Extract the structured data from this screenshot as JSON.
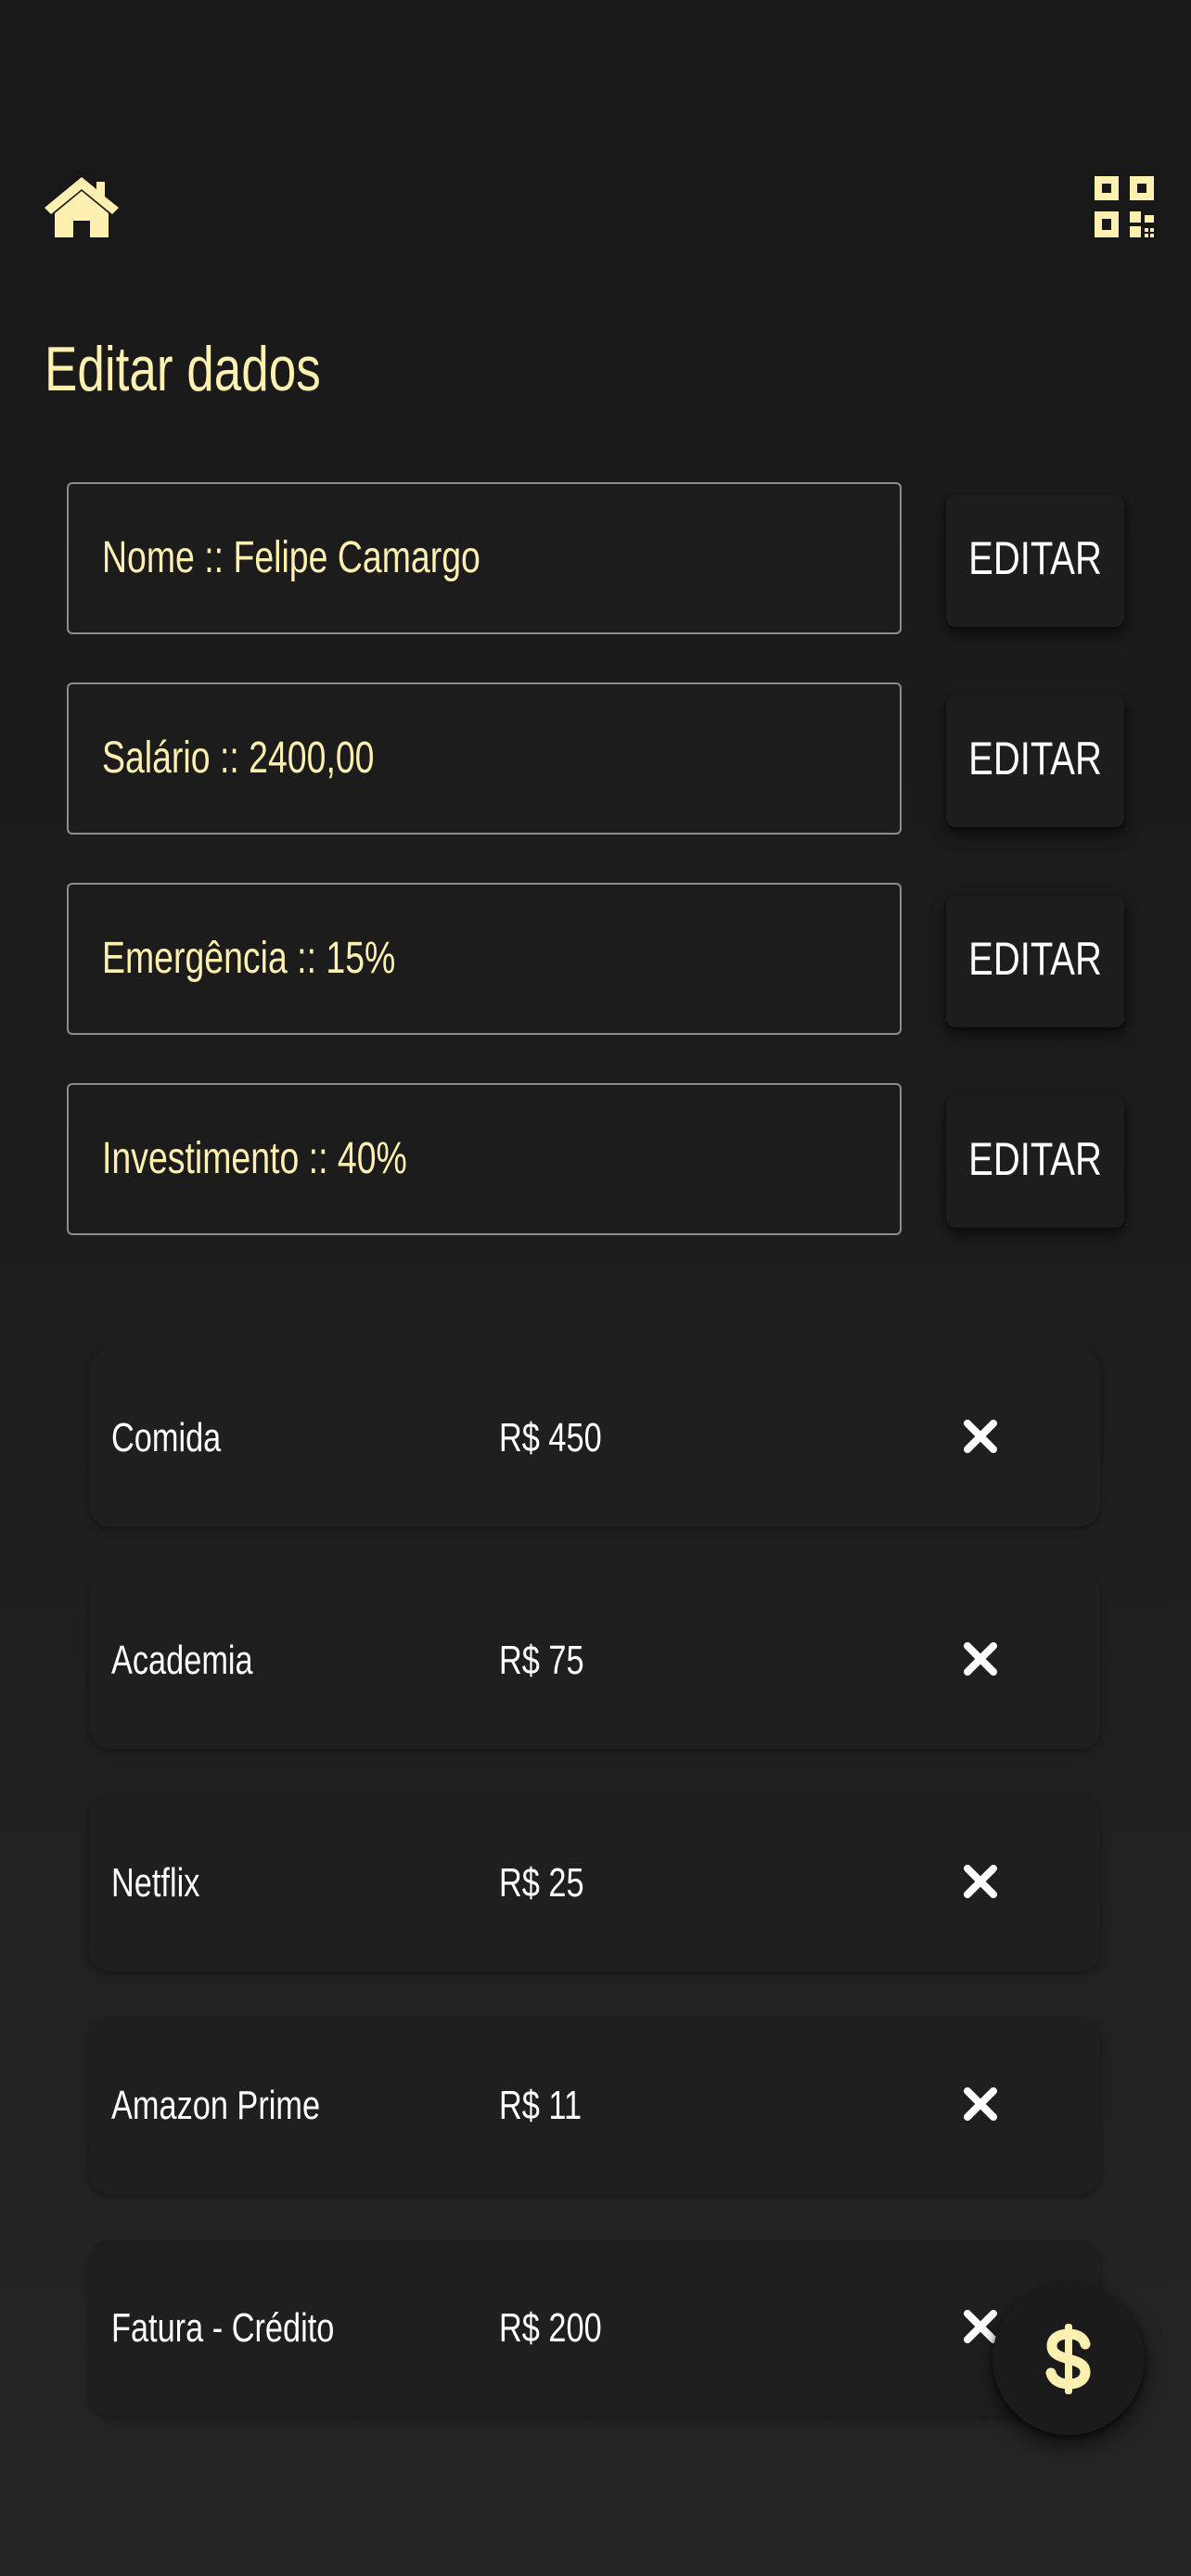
{
  "header": {
    "home_icon": "home-icon",
    "qr_icon": "qr-code-icon"
  },
  "page": {
    "title": "Editar dados"
  },
  "fields": [
    {
      "value": "Nome :: Felipe Camargo",
      "button_label": "EDITAR"
    },
    {
      "value": "Salário :: 2400,00",
      "button_label": "EDITAR"
    },
    {
      "value": "Emergência :: 15%",
      "button_label": "EDITAR"
    },
    {
      "value": "Investimento :: 40%",
      "button_label": "EDITAR"
    }
  ],
  "expenses": [
    {
      "name": "Comida",
      "value": "R$ 450"
    },
    {
      "name": "Academia",
      "value": "R$ 75"
    },
    {
      "name": "Netflix",
      "value": "R$ 25"
    },
    {
      "name": "Amazon Prime",
      "value": "R$ 11"
    },
    {
      "name": "Fatura - Crédito",
      "value": "R$ 200"
    }
  ],
  "fab": {
    "icon": "dollar-icon"
  },
  "colors": {
    "accent": "#fdf0b0",
    "background": "#1c1c1c",
    "text": "#ffffff"
  }
}
